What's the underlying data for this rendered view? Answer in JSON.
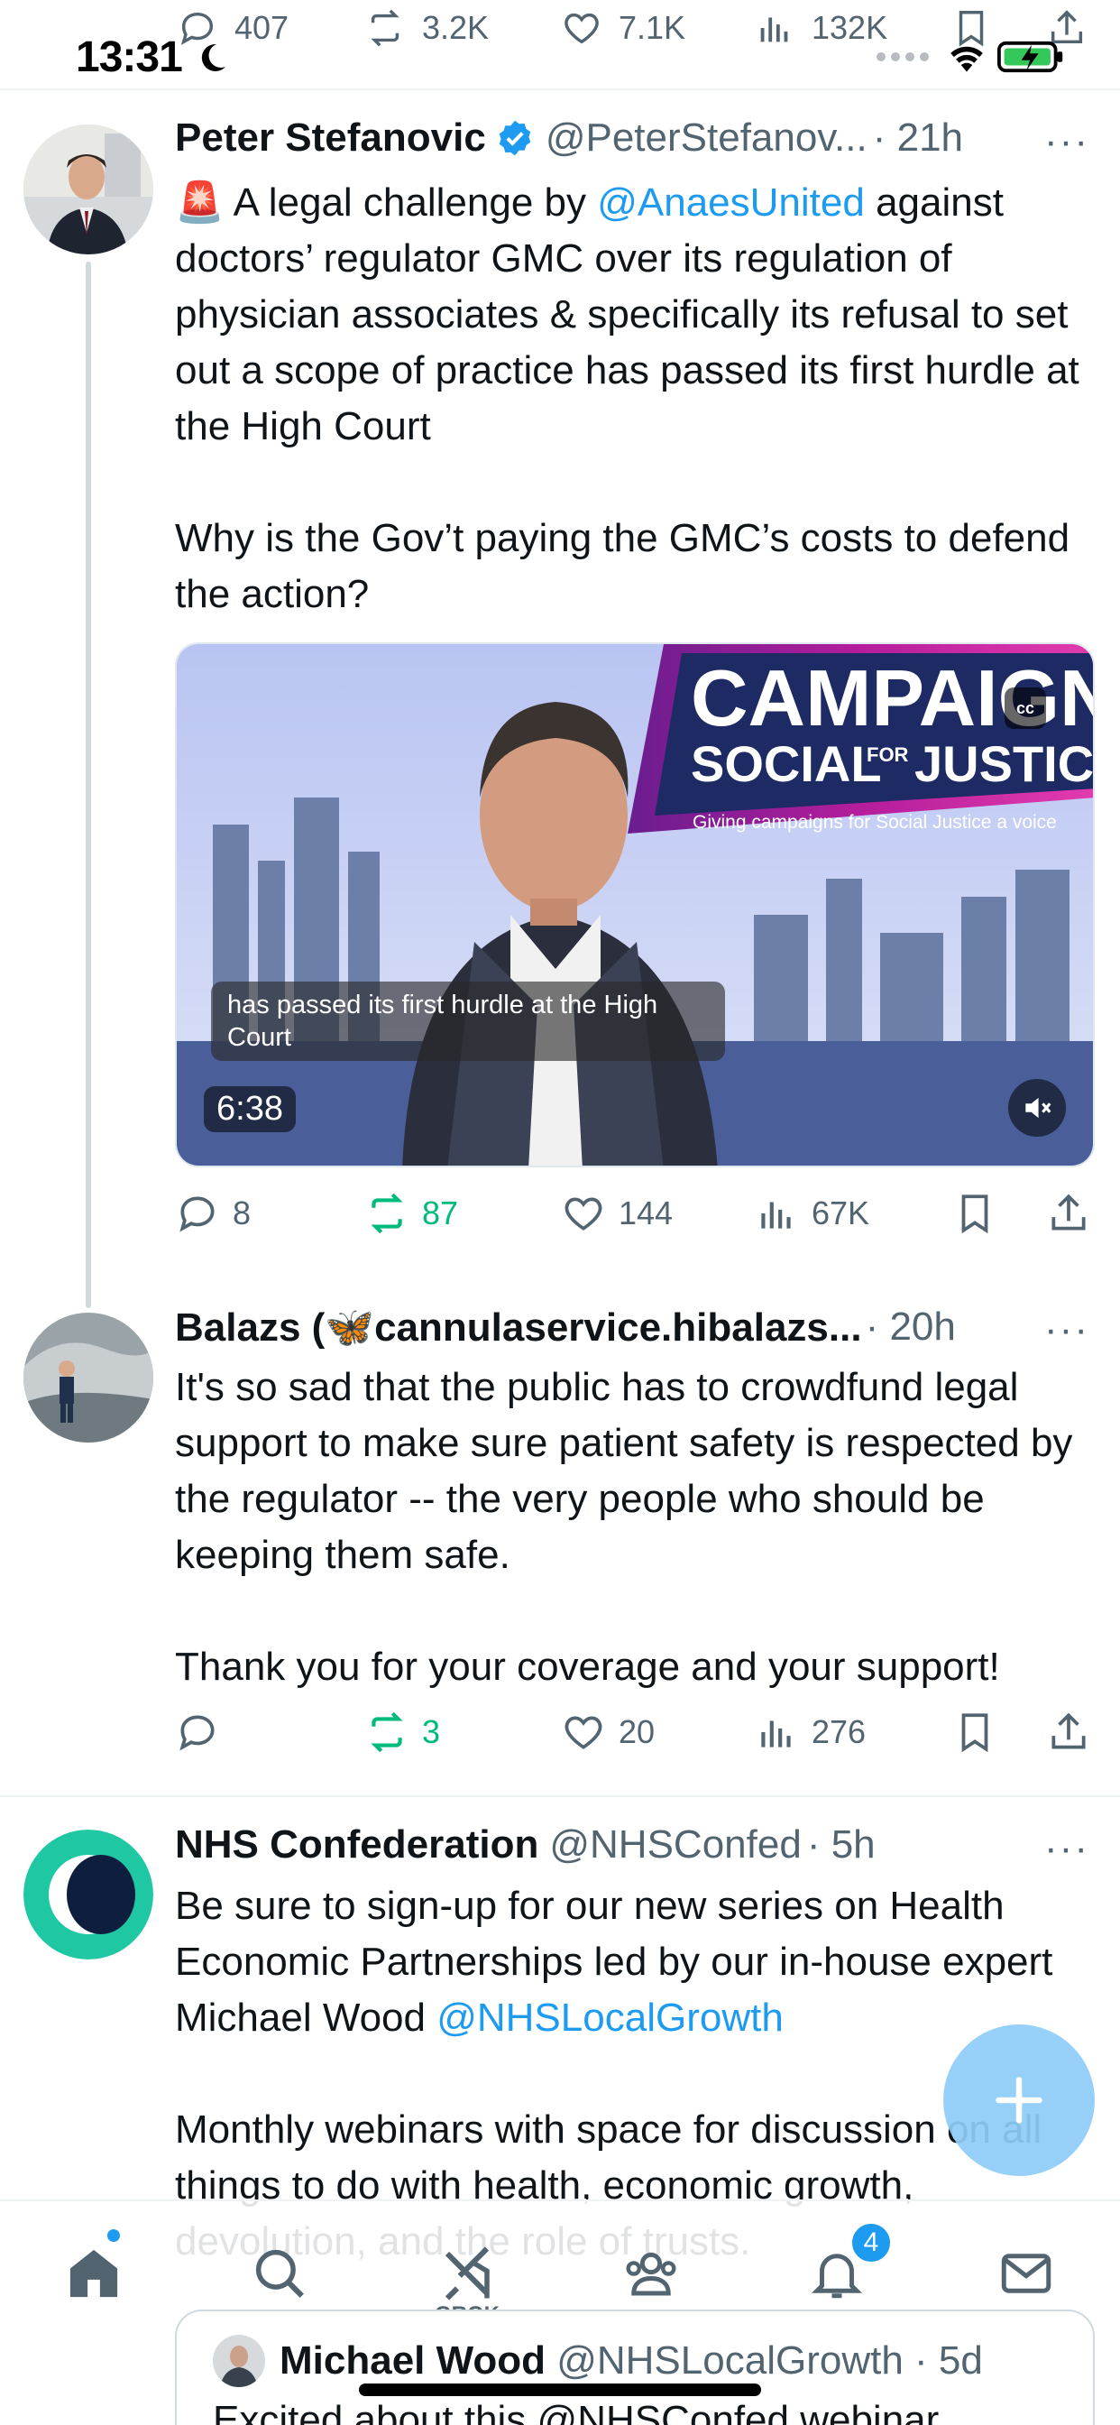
{
  "status_bar": {
    "time": "13:31"
  },
  "top_actions": {
    "replies": "407",
    "reposts": "3.2K",
    "likes": "7.1K",
    "views": "132K"
  },
  "tweets": [
    {
      "name": "Peter Stefanovic",
      "handle": "@PeterStefanov...",
      "time": "· 21h",
      "text_before_link": "🚨 A legal challenge by ",
      "link": "@AnaesUnited",
      "text_after_link": " against doctors’ regulator GMC over its regulation of physician associates & specifically its refusal to set out a scope of practice has passed its first hurdle at the High Court\n\nWhy is the Gov’t paying the GMC’s costs to defend the action?",
      "video": {
        "caption": "has passed its first hurdle at the High Court",
        "duration": "6:38",
        "banner_line1": "CAMPAIGN",
        "banner_line2": "SOCIAL",
        "banner_for": "FOR",
        "banner_line3": "JUSTICE",
        "banner_tagline": "Giving campaigns for Social Justice a voice",
        "cc_label": "cc"
      },
      "replies": "8",
      "reposts": "87",
      "likes": "144",
      "views": "67K"
    },
    {
      "name": "Balazs (🦋cannulaservice.hibalazs...",
      "handle": "",
      "time": "· 20h",
      "text": "It's so sad that the public has to crowdfund legal support to make sure patient safety is respected by the regulator -- the very people who should be keeping them safe.\n\nThank you for your coverage and your support!",
      "replies": "",
      "reposts": "3",
      "likes": "20",
      "views": "276"
    },
    {
      "name": "NHS Confederation",
      "handle": "@NHSConfed",
      "time": "· 5h",
      "text_before_link": "Be sure to sign-up for our new series on Health Economic Partnerships led by our in-house expert Michael Wood ",
      "link": "@NHSLocalGrowth",
      "text_after_link": "\n\nMonthly webinars with space for discussion on all things to do with health, economic growth, devolution, and the role of trusts.",
      "quoted": {
        "name": "Michael Wood",
        "handle": "@NHSLocalGrowth",
        "time": "· 5d",
        "text": "Excited about this @NHSConfed webinar"
      }
    }
  ],
  "bottom_nav": {
    "grok_label": "GROK",
    "notifications_badge": "4"
  },
  "more_label": "···",
  "colors": {
    "accent": "#1d9bf0",
    "repost_active": "#00ba7c",
    "secondary_text": "#536471"
  }
}
